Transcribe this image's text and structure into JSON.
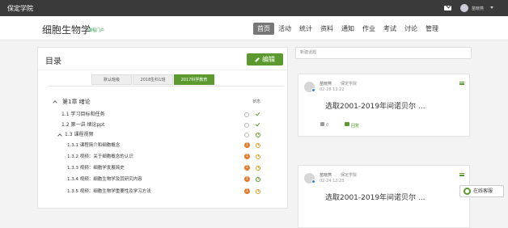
{
  "topbar": {
    "school": "保定学院",
    "username": "苗晓燕"
  },
  "header": {
    "course_title": "细胞生物学",
    "portal_link": "课程门户",
    "nav": [
      "首页",
      "活动",
      "统计",
      "资料",
      "通知",
      "作业",
      "考试",
      "讨论",
      "管理"
    ],
    "active_nav": "首页"
  },
  "catalog": {
    "title": "目录",
    "edit_label": "编辑",
    "tabs": [
      "默认班级",
      "2018生科1班",
      "2017科学教育"
    ],
    "active_tab": "2017科学教育",
    "status_header": "状态",
    "chapter": "第1章 绪论",
    "items": [
      {
        "label": "1.1  学习目标和任务",
        "status": "done"
      },
      {
        "label": "1.2  第一讲 绪论ppt",
        "status": "done"
      },
      {
        "label": "1.3  课程视频",
        "status": "pending"
      },
      {
        "label": "1.3.1  课程简介和细胞概念",
        "status": "task",
        "badge": "1"
      },
      {
        "label": "1.3.2  视频：关于细胞概念的认识",
        "status": "task",
        "badge": "1"
      },
      {
        "label": "1.3.3  视频：细胞学发展简史",
        "status": "task",
        "badge": "1"
      },
      {
        "label": "1.3.4  视频：细胞生物学及其研究内容",
        "status": "task",
        "badge": "1"
      },
      {
        "label": "1.3.5  视频：细胞生物学重要性及学习方法",
        "status": "task",
        "badge": "1"
      }
    ]
  },
  "discussion": {
    "new_topic_placeholder": "新建话题",
    "posts": [
      {
        "author": "苗晓燕",
        "org": "保定学院",
        "time": "02-28 13:22",
        "content": "选取2001-2019年间诺贝尔 ...",
        "likes": "0",
        "reply": "回复"
      },
      {
        "author": "苗晓燕",
        "org": "保定学院",
        "time": "02-24 12:23",
        "content": "选取2001-2019年间诺贝尔 ...",
        "likes": "",
        "reply": ""
      }
    ]
  },
  "service": {
    "label": "在线客服"
  },
  "colors": {
    "accent": "#5a9a2e",
    "topbar": "#3a3a3a",
    "badge": "#e77a2b"
  }
}
